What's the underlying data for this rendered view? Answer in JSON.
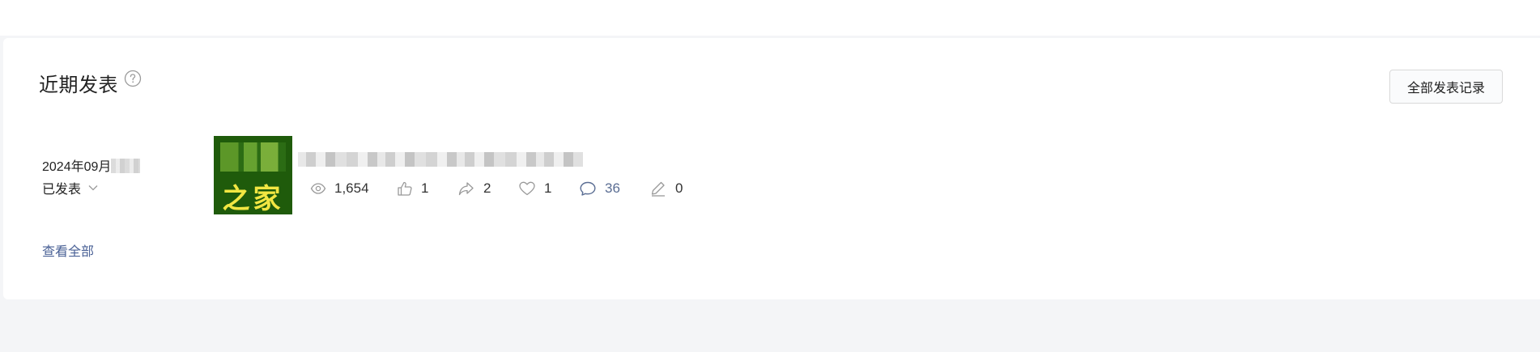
{
  "section": {
    "title": "近期发表",
    "all_records_label": "全部发表记录",
    "view_all_label": "查看全部"
  },
  "post": {
    "date": "2024年09月",
    "status": "已发表",
    "thumbnail_text": "之家",
    "stats": {
      "views": "1,654",
      "likes": "1",
      "shares": "2",
      "favorites": "1",
      "comments": "36",
      "edits": "0"
    }
  },
  "colors": {
    "link": "#4a6196",
    "thumbnail_bg": "#1f5b0b",
    "thumbnail_text": "#f2e642",
    "page_bg": "#f4f5f7"
  },
  "icons": {
    "help": "question-circle-icon",
    "status_dropdown": "chevron-down-icon",
    "views": "eye-icon",
    "likes": "thumbs-up-icon",
    "shares": "share-arrow-icon",
    "favorites": "heart-icon",
    "comments": "comment-bubble-icon",
    "edits": "pencil-icon"
  }
}
